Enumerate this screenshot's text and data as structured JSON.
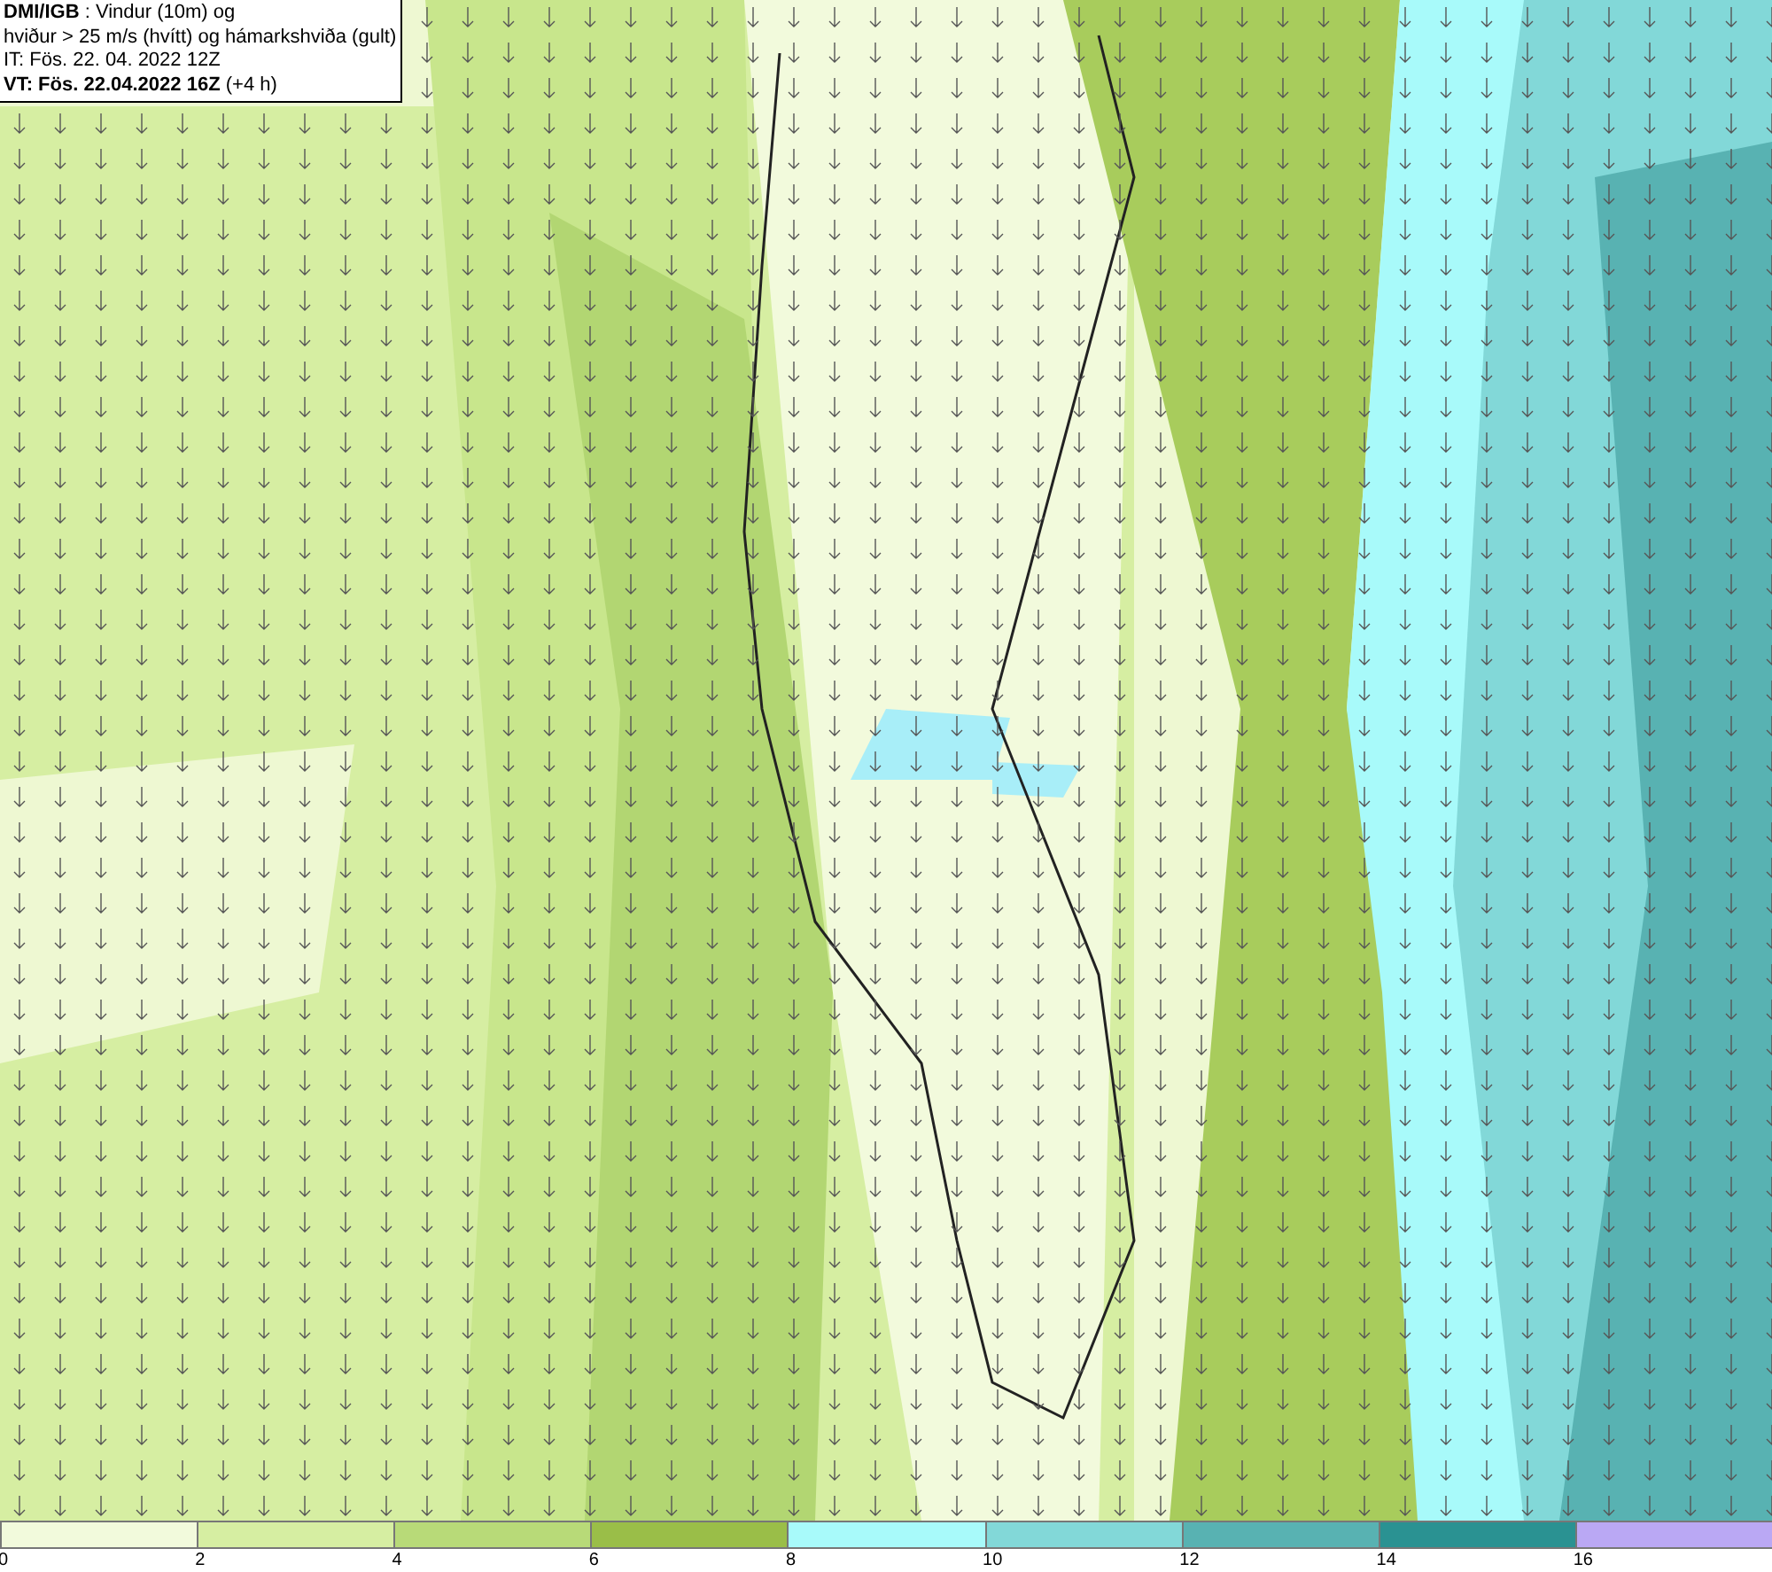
{
  "header": {
    "lines": [
      {
        "text": "**DMI/IGB** : Vindur (10m) og"
      },
      {
        "text": "hviður > 25 m/s (hvítt) og hámarkshviða (gult)"
      },
      {
        "text": "IT: Fös. 22. 04. 2022 12Z"
      },
      {
        "text": "**VT: Fös. 22.04.2022 16Z** (+4 h)"
      }
    ]
  },
  "legend": {
    "bins": [
      {
        "color": "#f2fadc"
      },
      {
        "color": "#d6eea2"
      },
      {
        "color": "#b8da78"
      },
      {
        "color": "#9abe48"
      },
      {
        "color": "#a8fafa"
      },
      {
        "color": "#82d8d8"
      },
      {
        "color": "#58b2b2"
      },
      {
        "color": "#2a9292"
      },
      {
        "color": "#baa8f4"
      }
    ],
    "ticks": [
      "0",
      "2",
      "4",
      "6",
      "8",
      "10",
      "12",
      "14",
      "16"
    ]
  }
}
